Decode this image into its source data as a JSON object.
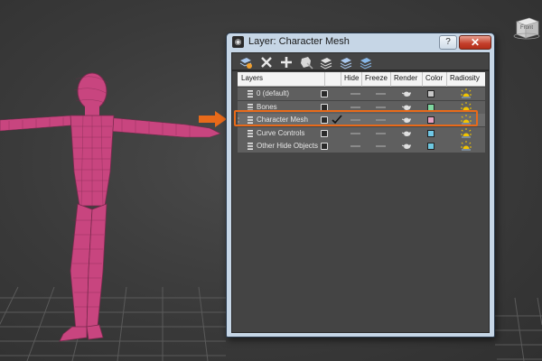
{
  "dialog": {
    "title": "Layer: Character Mesh",
    "help_label": "?",
    "close_label": "✕"
  },
  "toolbar": {
    "buttons": [
      {
        "icon": "create-new-layer-icon"
      },
      {
        "icon": "delete-layer-icon"
      },
      {
        "icon": "add-to-layer-icon"
      },
      {
        "icon": "select-objects-icon"
      },
      {
        "icon": "highlight-selected-icon"
      },
      {
        "icon": "hide-unhide-all-icon"
      },
      {
        "icon": "freeze-unfreeze-all-icon"
      }
    ]
  },
  "columns": {
    "layers": "Layers",
    "hide": "Hide",
    "freeze": "Freeze",
    "render": "Render",
    "color": "Color",
    "radiosity": "Radiosity"
  },
  "layers": [
    {
      "name": "0 (default)",
      "current": false,
      "color": "#c8c8c8"
    },
    {
      "name": "Bones",
      "current": false,
      "color": "#7fd6a0"
    },
    {
      "name": "Character Mesh",
      "current": true,
      "color": "#e6a0c0"
    },
    {
      "name": "Curve Controls",
      "current": false,
      "color": "#70c8e6"
    },
    {
      "name": "Other Hide Objects",
      "current": false,
      "color": "#6ec8e0"
    }
  ],
  "viewport": {
    "viewcube_label": "Front"
  },
  "colors": {
    "highlight": "#e86a1a",
    "mesh": "#c8457f"
  }
}
